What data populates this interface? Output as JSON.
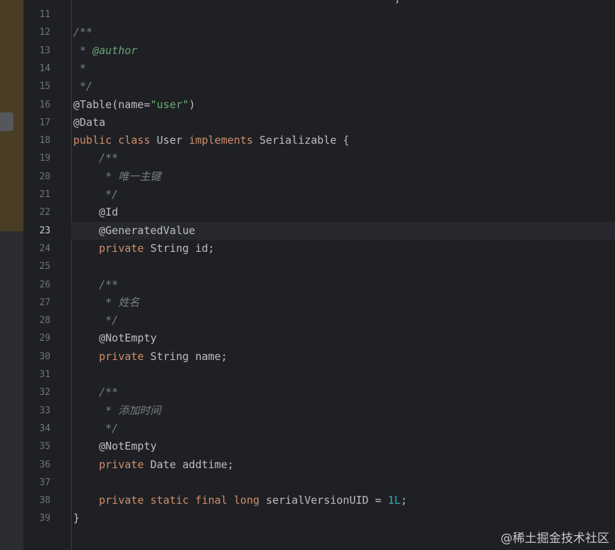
{
  "editor": {
    "current_line": 23,
    "cut_line_text": "                                                  ;",
    "lines": [
      {
        "n": "11",
        "segs": []
      },
      {
        "n": "12",
        "segs": [
          {
            "t": "/**",
            "c": "cmt"
          }
        ]
      },
      {
        "n": "13",
        "segs": [
          {
            "t": " * ",
            "c": "cmt"
          },
          {
            "t": "@author",
            "c": "doctag"
          }
        ]
      },
      {
        "n": "14",
        "segs": [
          {
            "t": " *",
            "c": "cmt"
          }
        ]
      },
      {
        "n": "15",
        "segs": [
          {
            "t": " */",
            "c": "cmt"
          }
        ]
      },
      {
        "n": "16",
        "segs": [
          {
            "t": "@Table",
            "c": "plain"
          },
          {
            "t": "(name=",
            "c": "plain"
          },
          {
            "t": "\"user\"",
            "c": "str"
          },
          {
            "t": ")",
            "c": "plain"
          }
        ]
      },
      {
        "n": "17",
        "segs": [
          {
            "t": "@Data",
            "c": "plain"
          }
        ]
      },
      {
        "n": "18",
        "segs": [
          {
            "t": "public ",
            "c": "kw"
          },
          {
            "t": "class ",
            "c": "kw"
          },
          {
            "t": "User ",
            "c": "plain"
          },
          {
            "t": "implements ",
            "c": "kw"
          },
          {
            "t": "Serializable {",
            "c": "plain"
          }
        ]
      },
      {
        "n": "19",
        "segs": [
          {
            "t": "    /**",
            "c": "cmt"
          }
        ]
      },
      {
        "n": "20",
        "segs": [
          {
            "t": "     * 唯一主键",
            "c": "cmt"
          }
        ]
      },
      {
        "n": "21",
        "segs": [
          {
            "t": "     */",
            "c": "cmt"
          }
        ]
      },
      {
        "n": "22",
        "segs": [
          {
            "t": "    @Id",
            "c": "plain"
          }
        ]
      },
      {
        "n": "23",
        "segs": [
          {
            "t": "    @GeneratedValue",
            "c": "plain"
          }
        ]
      },
      {
        "n": "24",
        "segs": [
          {
            "t": "    private ",
            "c": "kw"
          },
          {
            "t": "String id;",
            "c": "plain"
          }
        ]
      },
      {
        "n": "25",
        "segs": []
      },
      {
        "n": "26",
        "segs": [
          {
            "t": "    /**",
            "c": "cmt"
          }
        ]
      },
      {
        "n": "27",
        "segs": [
          {
            "t": "     * 姓名",
            "c": "cmt"
          }
        ]
      },
      {
        "n": "28",
        "segs": [
          {
            "t": "     */",
            "c": "cmt"
          }
        ]
      },
      {
        "n": "29",
        "segs": [
          {
            "t": "    @NotEmpty",
            "c": "plain"
          }
        ]
      },
      {
        "n": "30",
        "segs": [
          {
            "t": "    private ",
            "c": "kw"
          },
          {
            "t": "String name;",
            "c": "plain"
          }
        ]
      },
      {
        "n": "31",
        "segs": []
      },
      {
        "n": "32",
        "segs": [
          {
            "t": "    /**",
            "c": "cmt"
          }
        ]
      },
      {
        "n": "33",
        "segs": [
          {
            "t": "     * 添加时间",
            "c": "cmt"
          }
        ]
      },
      {
        "n": "34",
        "segs": [
          {
            "t": "     */",
            "c": "cmt"
          }
        ]
      },
      {
        "n": "35",
        "segs": [
          {
            "t": "    @NotEmpty",
            "c": "plain"
          }
        ]
      },
      {
        "n": "36",
        "segs": [
          {
            "t": "    private ",
            "c": "kw"
          },
          {
            "t": "Date addtime;",
            "c": "plain"
          }
        ]
      },
      {
        "n": "37",
        "segs": []
      },
      {
        "n": "38",
        "segs": [
          {
            "t": "    private ",
            "c": "kw"
          },
          {
            "t": "static ",
            "c": "kw"
          },
          {
            "t": "final ",
            "c": "kw"
          },
          {
            "t": "long ",
            "c": "kw"
          },
          {
            "t": "serialVersionUID = ",
            "c": "plain"
          },
          {
            "t": "1L",
            "c": "num"
          },
          {
            "t": ";",
            "c": "plain"
          }
        ]
      },
      {
        "n": "39",
        "segs": [
          {
            "t": "}",
            "c": "plain"
          }
        ]
      }
    ]
  },
  "watermark": "@稀土掘金技术社区",
  "colors": {
    "background": "#1f2023",
    "keyword": "#cf8e6d",
    "string": "#6aab73",
    "number": "#2aacb8",
    "comment": "#7a7e85",
    "doc_tag": "#67a37c",
    "plain": "#bcbec4"
  }
}
